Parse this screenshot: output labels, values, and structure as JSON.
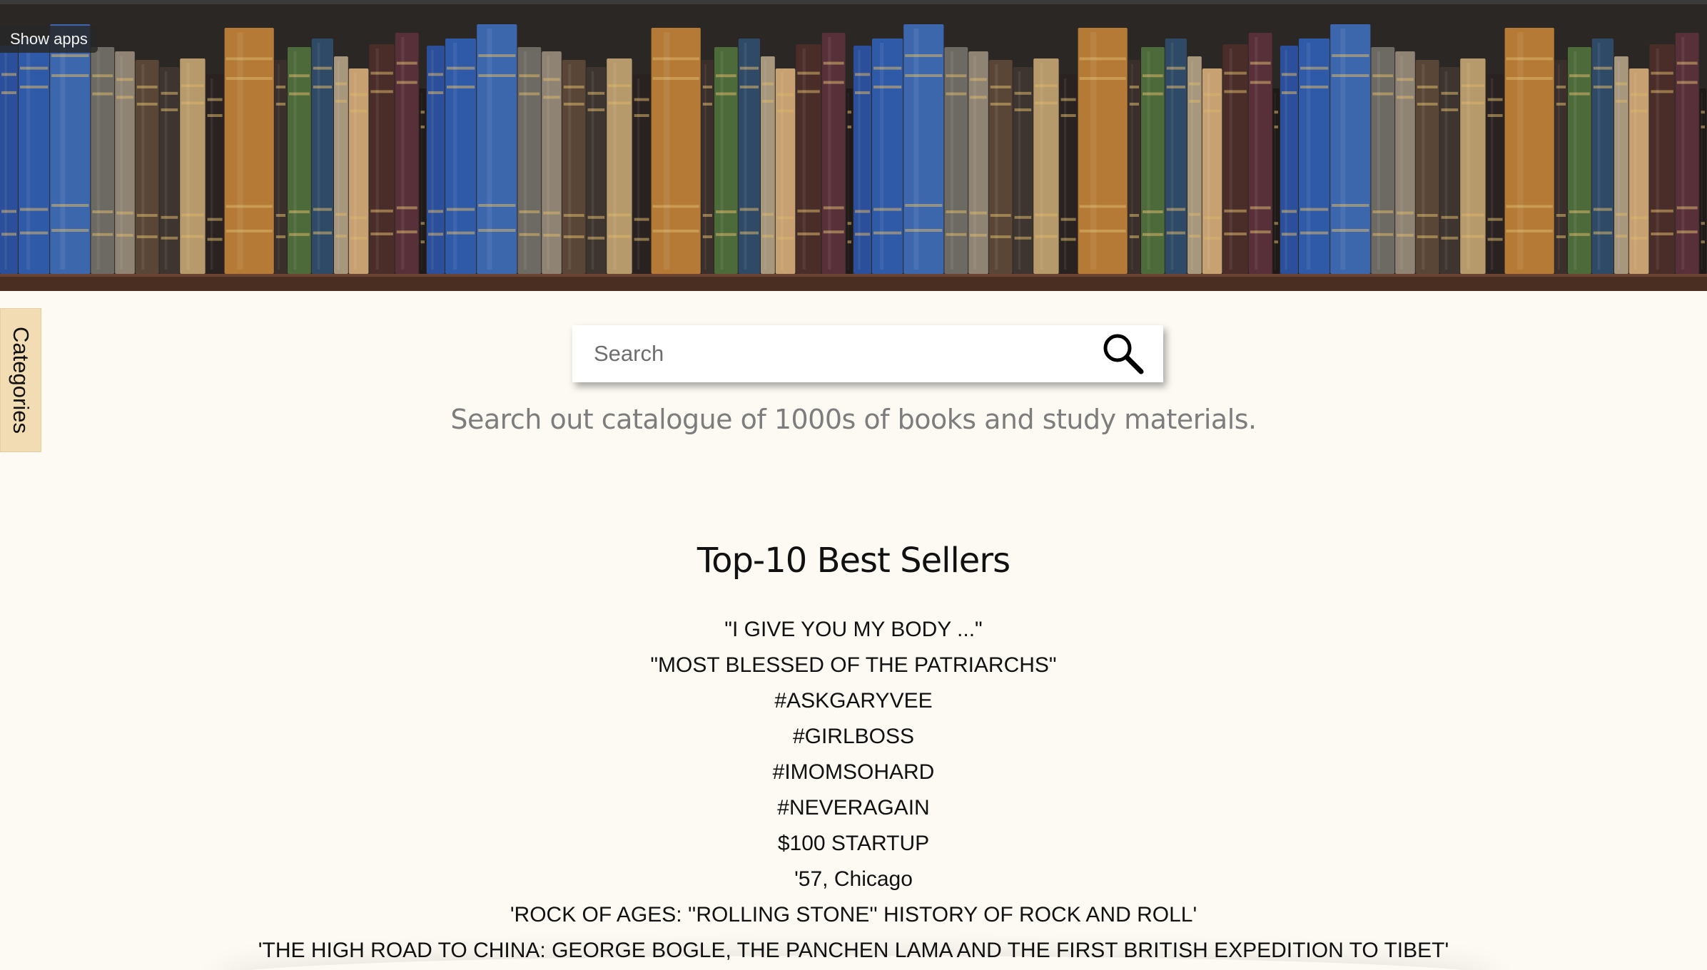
{
  "overlay": {
    "show_apps_label": "Show apps"
  },
  "banner": {
    "image_name": "antique-bookshelf-banner",
    "repeat_count": 4
  },
  "sidebar": {
    "categories_label": "Categories",
    "tab_color": "#f2dcb4"
  },
  "search": {
    "placeholder": "Search",
    "value": "",
    "button_icon": "magnifier-icon",
    "tagline": "Search out catalogue of 1000s of books and study materials."
  },
  "best_sellers": {
    "title": "Top-10 Best Sellers",
    "items": [
      "\"I GIVE YOU MY BODY ...\"",
      "\"MOST BLESSED OF THE PATRIARCHS\"",
      "#ASKGARYVEE",
      "#GIRLBOSS",
      "#IMOMSOHARD",
      "#NEVERAGAIN",
      "$100 STARTUP",
      "'57, Chicago",
      "'ROCK OF AGES: ''ROLLING STONE'' HISTORY OF ROCK AND ROLL'",
      "'THE HIGH ROAD TO CHINA: GEORGE BOGLE, THE PANCHEN LAMA AND THE FIRST BRITISH EXPEDITION TO TIBET'"
    ]
  },
  "colors": {
    "page_background": "#fdfaf3",
    "tagline_text": "#7d7d7d",
    "heading_text": "#111111"
  }
}
